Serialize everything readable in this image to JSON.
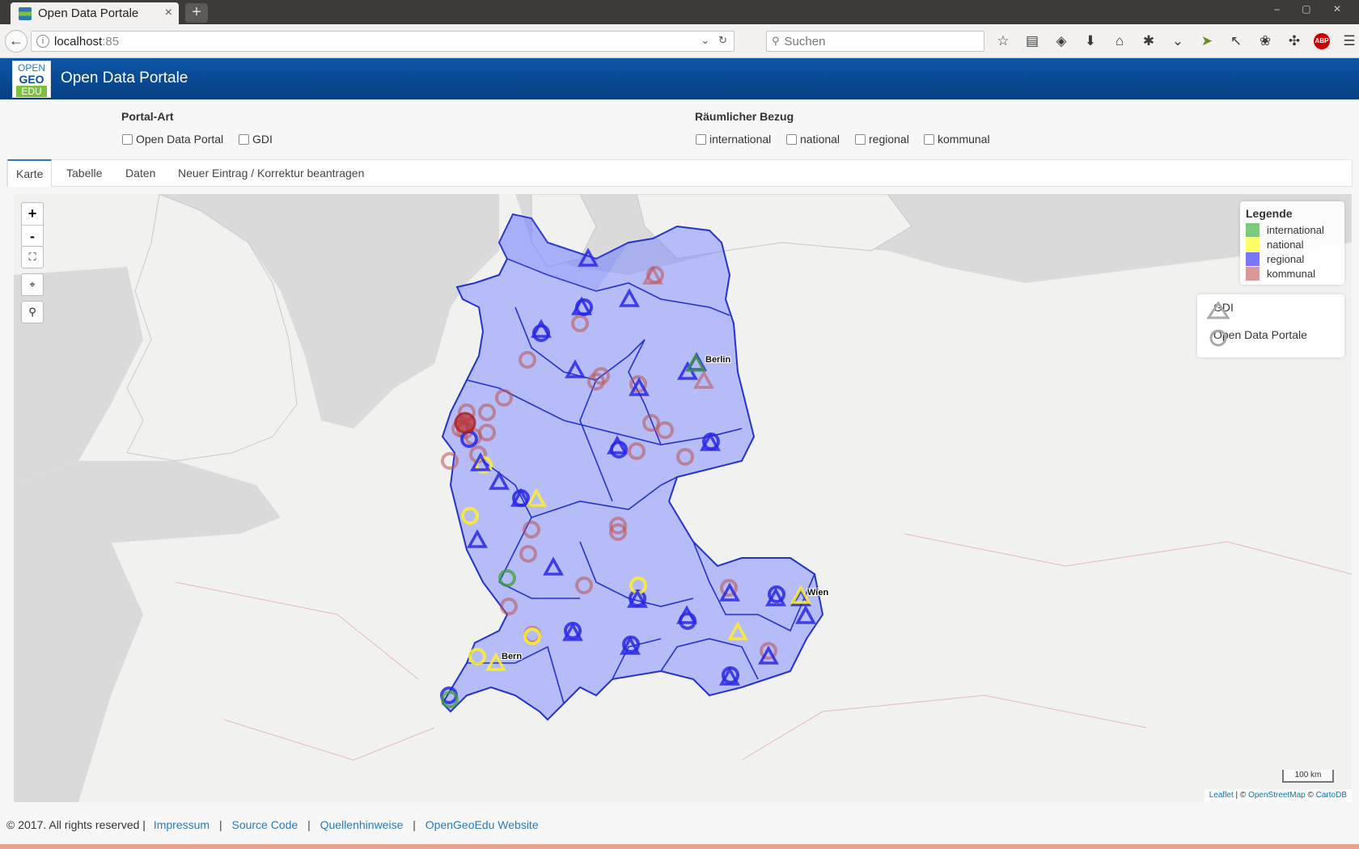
{
  "browser": {
    "tab_title": "Open Data Portale",
    "tab_close": "×",
    "new_tab": "+",
    "url_host": "localhost",
    "url_port": ":85",
    "search_placeholder": "Suchen",
    "toolbar_icons": [
      "bookmark-star-icon",
      "reader-view-icon",
      "pocket-icon",
      "download-icon",
      "home-icon",
      "extension-icon",
      "pocket-check-icon",
      "cursor-extension-icon",
      "share-icon",
      "extension-icon",
      "extension-icon",
      "adblock-icon",
      "menu-icon"
    ]
  },
  "header": {
    "logo_line1": "OPEN",
    "logo_line2": "GEO",
    "logo_line3": "EDU",
    "title": "Open Data Portale"
  },
  "filters": {
    "portal_type": {
      "title": "Portal-Art",
      "options": [
        "Open Data Portal",
        "GDI"
      ]
    },
    "spatial": {
      "title": "Räumlicher Bezug",
      "options": [
        "international",
        "national",
        "regional",
        "kommunal"
      ]
    }
  },
  "tabs": [
    "Karte",
    "Tabelle",
    "Daten",
    "Neuer Eintrag / Korrektur beantragen"
  ],
  "active_tab": "Karte",
  "map": {
    "zoom_in": "+",
    "zoom_out": "-",
    "legend": {
      "title": "Legende",
      "items": [
        {
          "label": "international",
          "color": "#7dc97d"
        },
        {
          "label": "national",
          "color": "#ffff66"
        },
        {
          "label": "regional",
          "color": "#7777ff"
        },
        {
          "label": "kommunal",
          "color": "#d99999"
        }
      ]
    },
    "shape_legend": {
      "gdi": "GDI",
      "odp": "Open Data Portale"
    },
    "cities": [
      "Berlin",
      "Wien",
      "Bern"
    ],
    "scale": "100 km",
    "attribution": {
      "leaflet": "Leaflet",
      "sep": " | © ",
      "osm": "OpenStreetMap",
      "sep2": " © ",
      "carto": "CartoDB"
    }
  },
  "footer": {
    "copyright": "© 2017. All rights reserved |",
    "links": [
      "Impressum",
      "Source Code",
      "Quellenhinweise",
      "OpenGeoEdu Website"
    ]
  }
}
